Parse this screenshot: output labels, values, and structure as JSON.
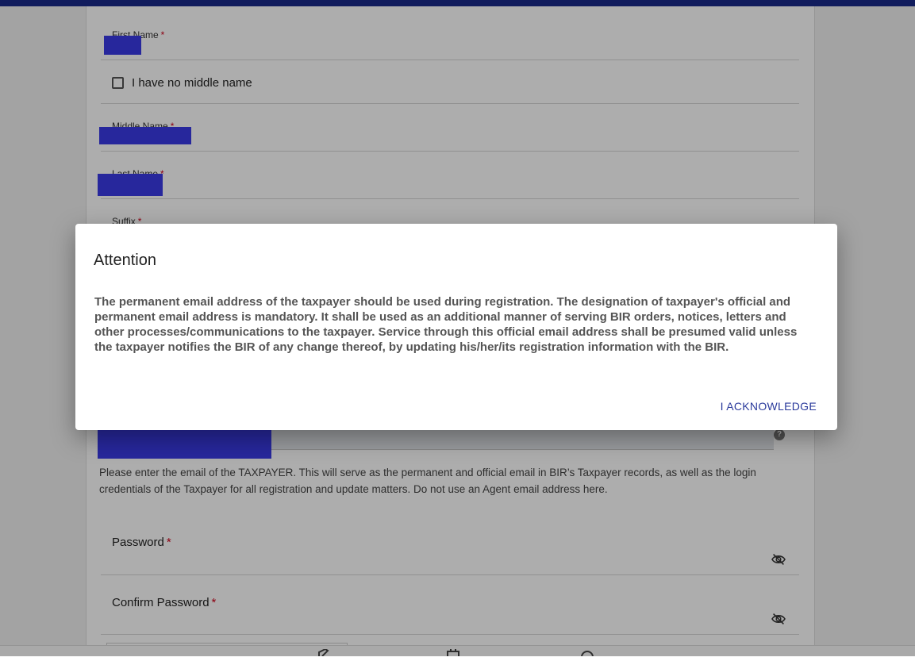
{
  "form": {
    "first_name_label": "First Name",
    "no_middle_name_label": "I have no middle name",
    "middle_name_label": "Middle Name",
    "last_name_label": "Last Name",
    "suffix_label": "Suffix",
    "required_mark": "*",
    "email_help_icon": "?",
    "email_hint": "Please enter the email of the TAXPAYER. This will serve as the permanent and official email in BIR’s Taxpayer records, as well as the login credentials of the Taxpayer for all registration and update matters. Do not use an Agent email address here.",
    "password_label": "Password",
    "confirm_password_label": "Confirm Password"
  },
  "icons": {
    "password_toggle": "eye-slash-icon",
    "help": "question-circle-icon"
  },
  "dialog": {
    "title": "Attention",
    "body": "The permanent email address of the taxpayer should be used during registration. The designation of taxpayer's official and permanent email address is mandatory. It shall be used as an additional manner of serving BIR orders, notices, letters and other processes/communications to the taxpayer. Service through this official email address shall be presumed valid unless the taxpayer notifies the BIR of any change thereof, by updating his/her/its registration information with the BIR.",
    "acknowledge_label": "I ACKNOWLEDGE"
  },
  "colors": {
    "header_bar": "#1a2a8a",
    "required": "#d0021b",
    "redaction": "#3a3ae6",
    "dialog_button": "#2b3b9c"
  }
}
